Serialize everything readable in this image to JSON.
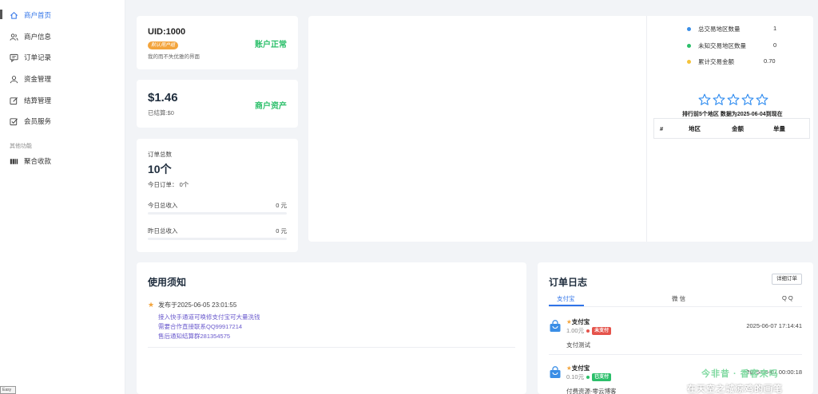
{
  "sidebar": {
    "items": [
      {
        "label": "商户首页",
        "icon": "home-icon"
      },
      {
        "label": "商户信息",
        "icon": "users-icon"
      },
      {
        "label": "订单记录",
        "icon": "chat-icon"
      },
      {
        "label": "资金管理",
        "icon": "user-icon"
      },
      {
        "label": "结算管理",
        "icon": "edit-icon"
      },
      {
        "label": "会员服务",
        "icon": "check-square-icon"
      }
    ],
    "section_label": "其他功能",
    "extra_items": [
      {
        "label": "聚合收款",
        "icon": "barcode-icon"
      }
    ],
    "corner_text": "Easy"
  },
  "account": {
    "uid": "UID:1000",
    "badge": "默认用户组",
    "note": "我的而不失优雅的界面",
    "status": "账户正常"
  },
  "balance": {
    "amount": "$1.46",
    "settled": "已结算:$0",
    "label": "商户资产"
  },
  "orders": {
    "title": "订单总数",
    "count": "10个",
    "today_orders_label": "今日订单：",
    "today_orders_value": "0个",
    "today_revenue_label": "今日总收入",
    "today_revenue_value": "0 元",
    "yesterday_revenue_label": "昨日总收入",
    "yesterday_revenue_value": "0 元"
  },
  "stats": {
    "legend": [
      {
        "label": "总交易地区数量",
        "value": "1",
        "color": "#3a8ee6"
      },
      {
        "label": "未知交易地区数量",
        "value": "0",
        "color": "#2bbf6a"
      },
      {
        "label": "累计交易金额",
        "value": "0.70",
        "color": "#f5c33b"
      }
    ],
    "rating": {
      "filled": 0,
      "total": 5
    },
    "rank_note": "排行前5个地区  数据为2025-06-04到现在",
    "table_headers": [
      "#",
      "地区",
      "金额",
      "单量"
    ]
  },
  "notice": {
    "title": "使用须知",
    "date": "发布于2025-06-05 23:01:55",
    "lines": [
      "接入快手通道可唤修支付宝可大量洗钱",
      "需要合作直接联系QQ99917214",
      "售后通知结算群281354575"
    ]
  },
  "order_log": {
    "title": "订单日志",
    "detail_button": "详细订单",
    "tabs": [
      "支付宝",
      "微 信",
      "Q Q"
    ],
    "entries": [
      {
        "name": "支付宝",
        "amount": "1.00元",
        "status": "未支付",
        "status_color": "#e5534b",
        "time": "2025-06-07 17:14:41",
        "desc": "支付测试"
      },
      {
        "name": "支付宝",
        "amount": "0.10元",
        "status": "已支付",
        "status_color": "#2bbf6a",
        "time": "2025-06-07 00:00:18",
        "desc": "付费资源-零云博客"
      }
    ]
  },
  "watermark": {
    "line1": "今非昔 · 香客来吗",
    "line2": "在天空之城凉鸡的画笔"
  }
}
